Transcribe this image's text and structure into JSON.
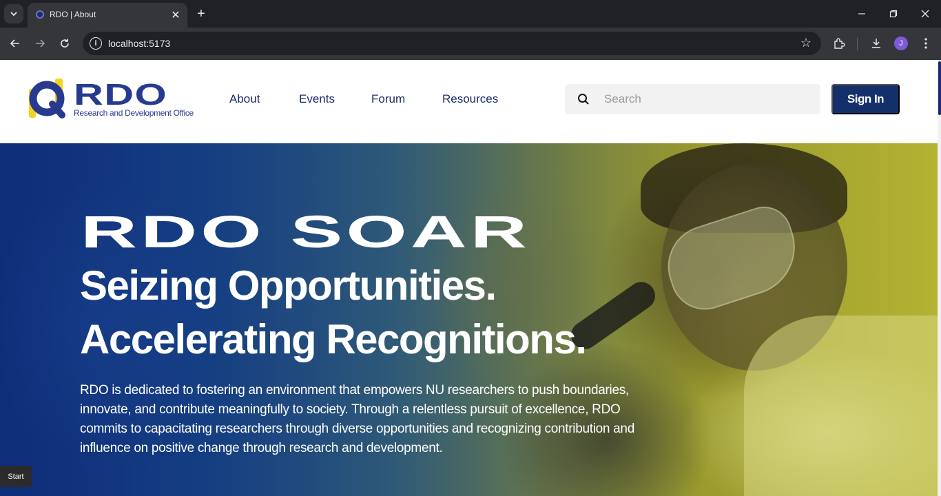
{
  "browser": {
    "tab_title": "RDO | About",
    "url": "localhost:5173",
    "profile_initial": "J"
  },
  "header": {
    "logo_text": "RDO",
    "logo_subtitle": "Research and Development Office",
    "nav": [
      "About",
      "Events",
      "Forum",
      "Resources"
    ],
    "search_placeholder": "Search",
    "signin_label": "Sign In"
  },
  "hero": {
    "eyebrow": "RDO SOAR",
    "line1": "Seizing Opportunities.",
    "line2": "Accelerating Recognitions.",
    "body": "RDO is dedicated to fostering an environment that empowers NU researchers to push boundaries, innovate, and contribute meaningfully to society. Through a relentless pursuit of excellence, RDO commits to capacitating researchers through diverse opportunities and recognizing contribution and influence on positive change through research and development."
  },
  "tooltip": {
    "label": "Start"
  },
  "colors": {
    "brand_navy": "#14306b",
    "logo_blue": "#283a8f",
    "logo_yellow": "#f4d21f"
  }
}
